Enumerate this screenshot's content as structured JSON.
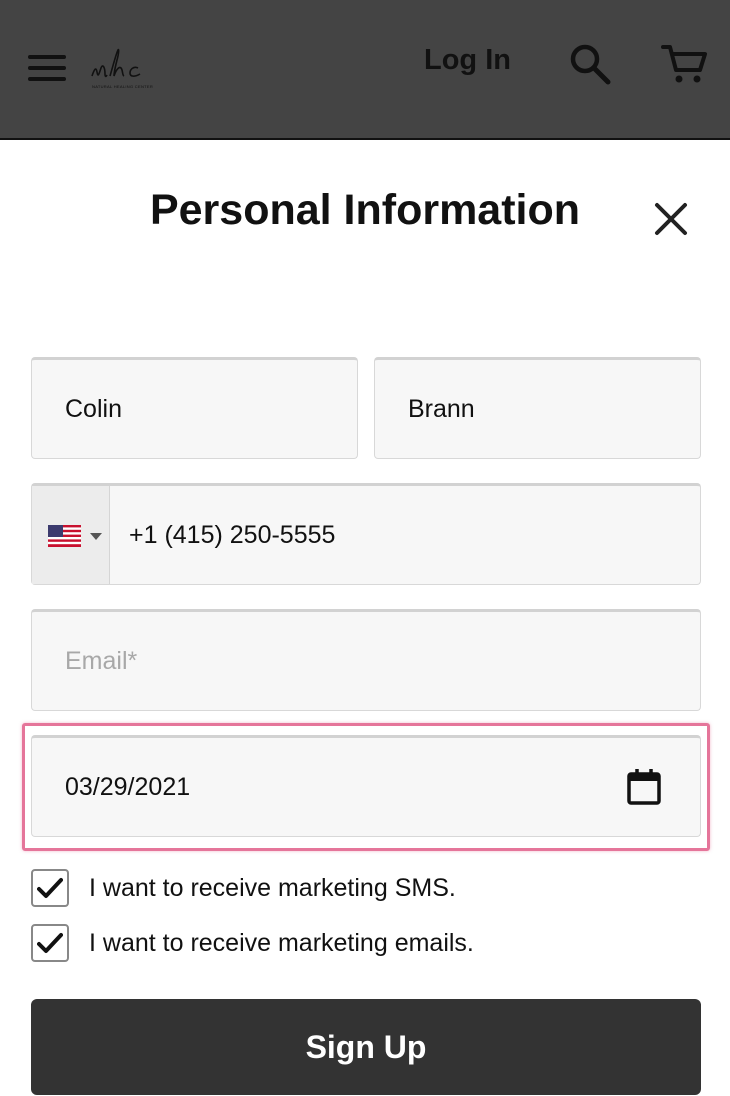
{
  "header": {
    "logo_text": "nhc",
    "logo_subtitle": "NATURAL HEALING CENTER",
    "login_label": "Log In",
    "icons": [
      "menu-icon",
      "search-icon",
      "cart-icon"
    ]
  },
  "page": {
    "title": "Personal Information",
    "close_icon": "close-icon"
  },
  "form": {
    "first_name": "Colin",
    "last_name": "Brann",
    "phone": {
      "country_flag": "us-flag-icon",
      "value": "+1 (415) 250-5555"
    },
    "email_placeholder": "Email*",
    "birth_date": "03/29/2021",
    "sms_opt_in": {
      "label": "I want to receive marketing SMS.",
      "checked": true
    },
    "email_opt_in": {
      "label": "I want to receive marketing emails.",
      "checked": true
    },
    "submit_label": "Sign Up"
  },
  "colors": {
    "header_bg": "#444444",
    "highlight_border": "#e5759a",
    "button_bg": "#333333"
  }
}
